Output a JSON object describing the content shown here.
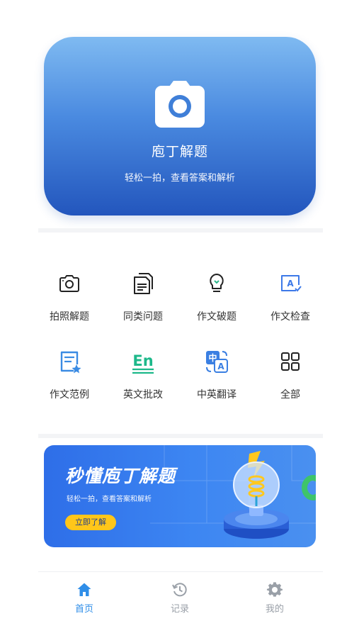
{
  "hero": {
    "title": "庖丁解题",
    "subtitle": "轻松一拍，查看答案和解析",
    "icon": "camera-icon"
  },
  "tools": [
    {
      "label": "拍照解题",
      "icon": "camera-outline-icon"
    },
    {
      "label": "同类问题",
      "icon": "documents-icon"
    },
    {
      "label": "作文破题",
      "icon": "lightbulb-icon"
    },
    {
      "label": "作文检查",
      "icon": "essay-check-icon"
    },
    {
      "label": "作文范例",
      "icon": "essay-example-icon"
    },
    {
      "label": "英文批改",
      "icon": "english-en-icon"
    },
    {
      "label": "中英翻译",
      "icon": "translate-icon"
    },
    {
      "label": "全部",
      "icon": "grid-icon"
    }
  ],
  "banner": {
    "title": "秒懂庖丁解题",
    "subtitle": "轻松一拍，查看答案和解析",
    "button": "立即了解"
  },
  "nav": {
    "items": [
      {
        "label": "首页",
        "icon": "home-icon",
        "active": true
      },
      {
        "label": "记录",
        "icon": "history-icon",
        "active": false
      },
      {
        "label": "我的",
        "icon": "gear-icon",
        "active": false
      }
    ]
  },
  "colors": {
    "accent": "#2f8ee8",
    "inactive": "#9aa0a8",
    "banner_button": "#ffc61a"
  }
}
